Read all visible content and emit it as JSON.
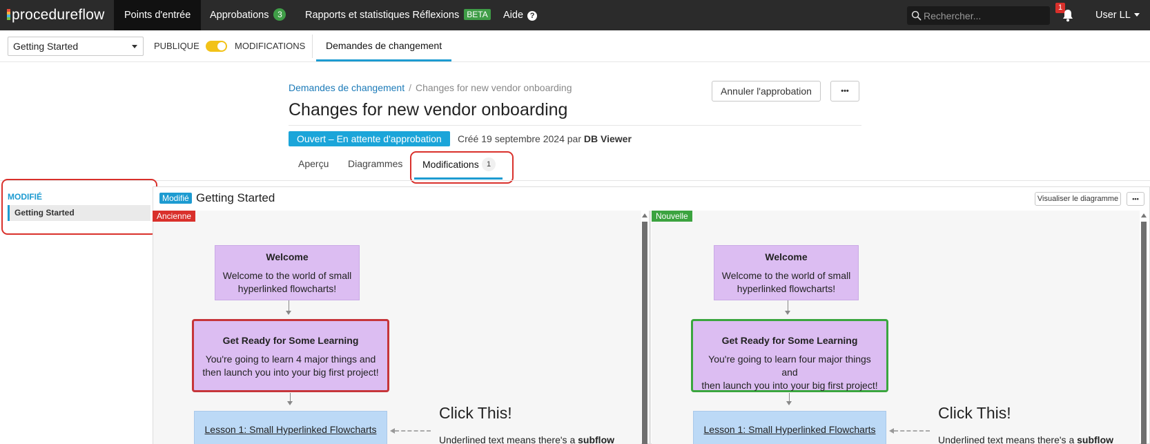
{
  "app": {
    "logo": "procedureflow",
    "nav": [
      {
        "label": "Points d'entrée"
      },
      {
        "label": "Approbations",
        "count": "3"
      },
      {
        "label": "Rapports et statistiques Réflexions",
        "badge": "BETA"
      },
      {
        "label": "Aide"
      }
    ],
    "search_placeholder": "Rechercher...",
    "notifications": "1",
    "user": "User LL"
  },
  "toolbar": {
    "select_value": "Getting Started",
    "left_label": "PUBLIQUE",
    "right_label": "MODIFICATIONS",
    "tab": "Demandes de changement"
  },
  "header": {
    "breadcrumb_link": "Demandes de changement",
    "breadcrumb_separator": "/",
    "breadcrumb_current": "Changes for new vendor onboarding",
    "title": "Changes for new vendor onboarding",
    "cancel_button": "Annuler l'approbation",
    "more_button": "•••",
    "status": "Ouvert – En attente d'approbation",
    "created_prefix": "Créé 19 septembre 2024 par",
    "created_by": "DB Viewer",
    "tabs": [
      {
        "label": "Aperçu"
      },
      {
        "label": "Diagrammes"
      },
      {
        "label": "Modifications",
        "count": "1"
      }
    ]
  },
  "sidebar": {
    "heading": "MODIFIÉ",
    "items": [
      {
        "label": "Getting Started"
      }
    ]
  },
  "panel": {
    "badge": "Modifié",
    "title": "Getting Started",
    "view_button": "Visualiser le diagramme",
    "more_button": "•••",
    "old_label": "Ancienne",
    "new_label": "Nouvelle",
    "old": {
      "welcome_title": "Welcome",
      "welcome_line1": "Welcome to the world of small",
      "welcome_line2": "hyperlinked flowcharts!",
      "ready_title": "Get Ready for Some Learning",
      "ready_line1": "You're going to learn 4 major things and",
      "ready_line2": "then launch you into your big first project!",
      "lesson": "Lesson 1: Small Hyperlinked Flowcharts",
      "click_title": "Click This!",
      "click_text": "Underlined text means there's a",
      "click_bold": "subflow"
    },
    "new": {
      "welcome_title": "Welcome",
      "welcome_line1": "Welcome to the world of small",
      "welcome_line2": "hyperlinked flowcharts!",
      "ready_title": "Get Ready for Some Learning",
      "ready_line1": "You're going to learn four major things and",
      "ready_line2": "then launch you into your big first project!",
      "lesson": "Lesson 1: Small Hyperlinked Flowcharts",
      "click_title": "Click This!",
      "click_text": "Underlined text means there's a",
      "click_bold": "subflow"
    }
  },
  "colors": {
    "accent": "#1d9bd1",
    "removed": "#d9302b",
    "added": "#3ba33f",
    "node_purple": "#dcbdf2",
    "node_blue": "#bcd9f6"
  }
}
